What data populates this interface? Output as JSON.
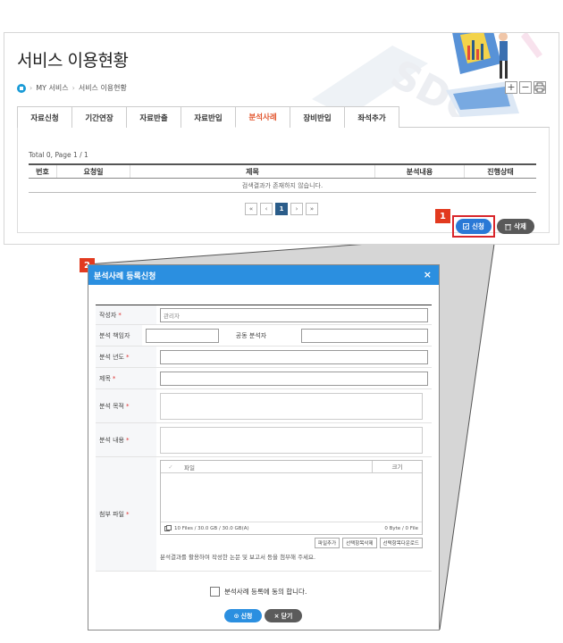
{
  "page": {
    "title": "서비스 이용현황",
    "breadcrumb": [
      "MY 서비스",
      "서비스 이용현황"
    ],
    "window_controls": [
      "+",
      "−",
      "⎙"
    ]
  },
  "tabs": [
    {
      "label": "자료신청",
      "active": false
    },
    {
      "label": "기간연장",
      "active": false
    },
    {
      "label": "자료반출",
      "active": false
    },
    {
      "label": "자료반입",
      "active": false
    },
    {
      "label": "분석사례",
      "active": true
    },
    {
      "label": "장비반입",
      "active": false
    },
    {
      "label": "좌석추가",
      "active": false
    }
  ],
  "list": {
    "total_text": "Total 0,   Page 1 / 1",
    "columns": [
      "번호",
      "요청일",
      "제목",
      "분석내용",
      "진행상태"
    ],
    "empty_text": "검색결과가 존재하지 않습니다.",
    "pager": [
      "«",
      "‹",
      "1",
      "›",
      "»"
    ]
  },
  "actions": {
    "apply_label": "신청",
    "delete_label": "삭제"
  },
  "markers": {
    "one": "1",
    "two": "2"
  },
  "dialog": {
    "title": "분석사례 등록신청",
    "close": "×",
    "fields": {
      "author_label": "작성자",
      "author_value": "관리자",
      "lead_label": "분석 책임자",
      "co_label": "공동 분석자",
      "year_label": "분석 년도",
      "subject_label": "제목",
      "purpose_label": "분석 목적",
      "content_label": "분석 내용",
      "attach_label": "첨부 파일"
    },
    "file": {
      "col_file": "파일",
      "col_size": "크기",
      "summary": "10 Files / 30.0 GB / 30.0 GB(A)",
      "size_total": "0 Byte / 0 File",
      "btn_add": "파일추가",
      "btn_delete": "선택항목삭제",
      "btn_download": "선택항목다운로드",
      "note": "분석결과를 활용하여 작성한 논문 및 보고서 등을 첨부해 주세요."
    },
    "agree_text": "분석사례 등록에 동의 합니다.",
    "submit_label": "신청",
    "close_label": "닫기"
  },
  "colors": {
    "accent_blue": "#2b8fe0",
    "active_tab": "#e2562e",
    "marker_red": "#e23a1f",
    "highlight": "#d9252a"
  }
}
